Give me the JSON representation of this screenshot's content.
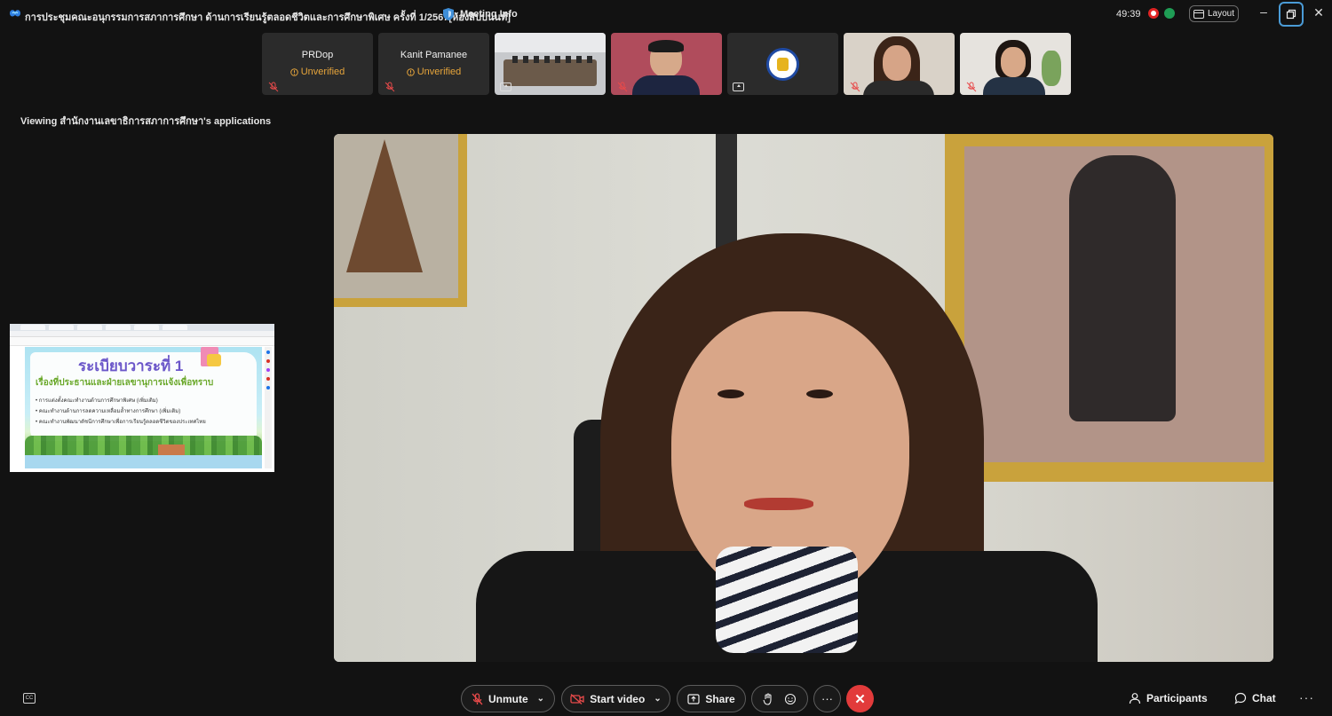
{
  "titlebar": {
    "meeting_title": "การประชุมคณะอนุกรรมการสภาการศึกษา ด้านการเรียนรู้ตลอดชีวิตและการศึกษาพิเศษ ครั้งที่ 1/2567[ห้องสิปปนนท์]",
    "meeting_info": "Meeting Info",
    "timer": "49:39",
    "layout_label": "Layout"
  },
  "filmstrip": {
    "tiles": [
      {
        "name": "PRDop",
        "status": "Unverified"
      },
      {
        "name": "Kanit Pamanee",
        "status": "Unverified"
      }
    ]
  },
  "viewing_text": "Viewing สำนักงานเลขาธิการสภาการศึกษา's applications",
  "shared_slide": {
    "title": "ระเบียบวาระที่ 1",
    "subtitle": "เรื่องที่ประธานและฝ่ายเลขานุการแจ้งเพื่อทราบ",
    "items": [
      "การแต่งตั้งคณะทำงานด้านการศึกษาพิเศษ (เพิ่มเติม)",
      "คณะทำงานด้านการลดความเหลื่อมล้ำทางการศึกษา (เพิ่มเติม)",
      "คณะทำงานพัฒนาดัชนีการศึกษาเพื่อการเรียนรู้ตลอดชีวิตของประเทศไทย"
    ]
  },
  "controls": {
    "cc_label": "CC",
    "unmute": "Unmute",
    "start_video": "Start video",
    "share": "Share",
    "participants": "Participants",
    "chat": "Chat"
  },
  "colors": {
    "accent": "#4a9bd6",
    "leave": "#e23b3b",
    "unverified": "#e7a53b"
  },
  "icons": [
    "app-logo-icon",
    "shield-icon",
    "record-icon",
    "network-icon",
    "layout-icon",
    "minimize-icon",
    "restore-icon",
    "close-icon",
    "mic-muted-icon",
    "video-off-icon",
    "share-icon",
    "raise-hand-icon",
    "reaction-icon",
    "more-icon",
    "leave-icon",
    "participants-icon",
    "chat-icon"
  ]
}
